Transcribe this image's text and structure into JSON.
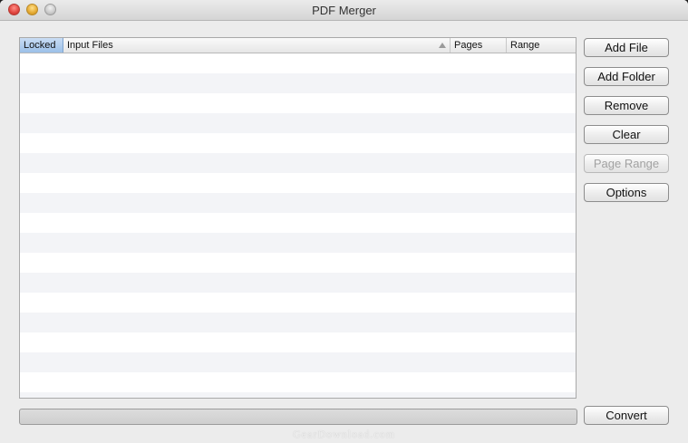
{
  "window": {
    "title": "PDF Merger"
  },
  "table": {
    "columns": [
      {
        "label": "Locked",
        "selected": true
      },
      {
        "label": "Input Files",
        "sorted": "ascending"
      },
      {
        "label": "Pages"
      },
      {
        "label": "Range"
      }
    ],
    "rows": []
  },
  "buttons": {
    "add_file": "Add File",
    "add_folder": "Add Folder",
    "remove": "Remove",
    "clear": "Clear",
    "page_range": "Page Range",
    "options": "Options",
    "convert": "Convert"
  },
  "progress": {
    "value_percent": 0
  },
  "watermark": "GearDownload.com",
  "colors": {
    "selected_header": "#9bbfe8",
    "row_stripe": "#f3f4f7",
    "disabled_text": "#a2a2a2"
  },
  "icons": {
    "sort_indicator": "triangle-up-icon"
  }
}
